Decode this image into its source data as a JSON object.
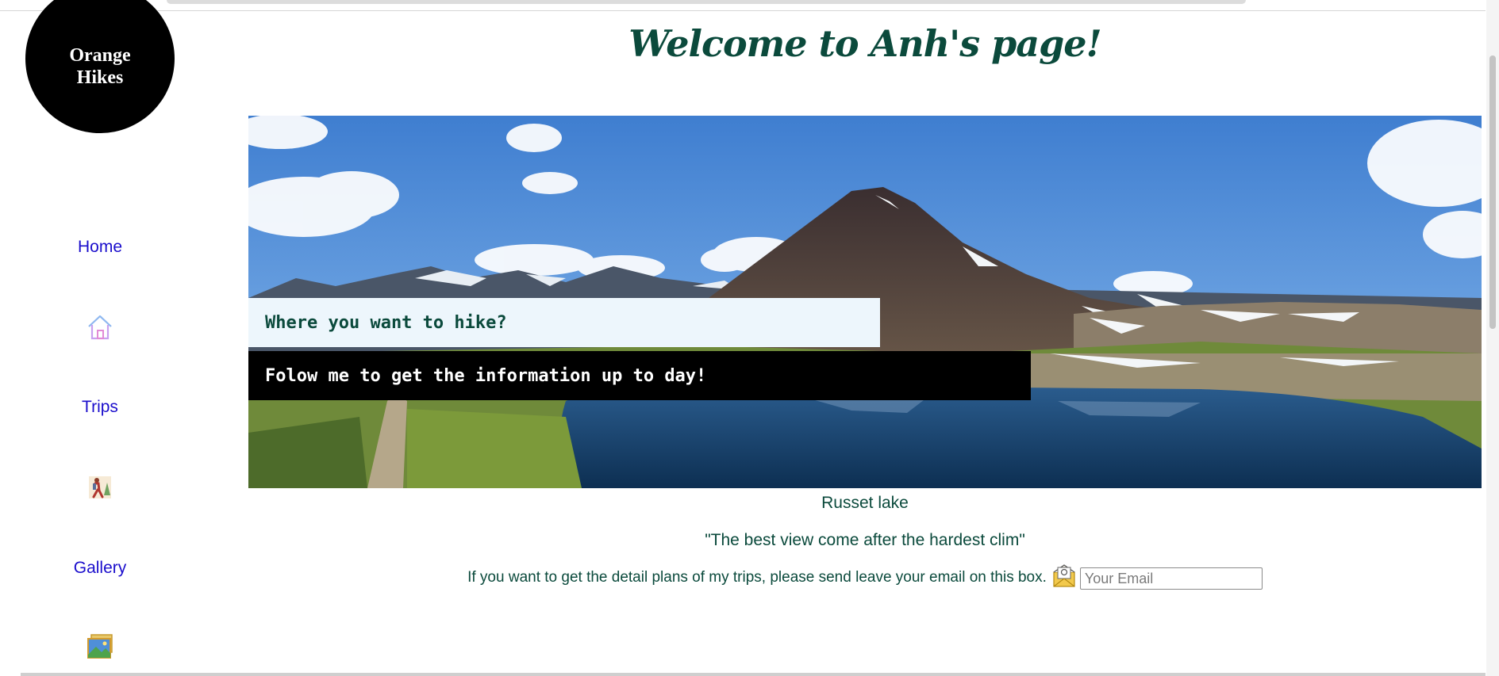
{
  "logo": {
    "line1": "Orange",
    "line2": "Hikes"
  },
  "nav": {
    "items": [
      {
        "label": "Home",
        "icon": "house-icon"
      },
      {
        "label": "Trips",
        "icon": "hiker-icon"
      },
      {
        "label": "Gallery",
        "icon": "gallery-icon"
      }
    ]
  },
  "header": {
    "title": "Welcome to Anh's page!"
  },
  "hero": {
    "banner_question": "Where you want to hike?",
    "banner_follow": "Folow me to get the information up to day!",
    "caption": "Russet lake"
  },
  "quote": "\"The best view come after the hardest clim\"",
  "signup": {
    "text": "If you want to get the detail plans of my trips, please send leave your email on this box.",
    "icon": "mail-icon",
    "placeholder": "Your Email"
  },
  "colors": {
    "heading": "#0b4a3c",
    "link": "#1a0dcc",
    "logo_bg": "#000000",
    "banner_light": "#edf6fc"
  }
}
